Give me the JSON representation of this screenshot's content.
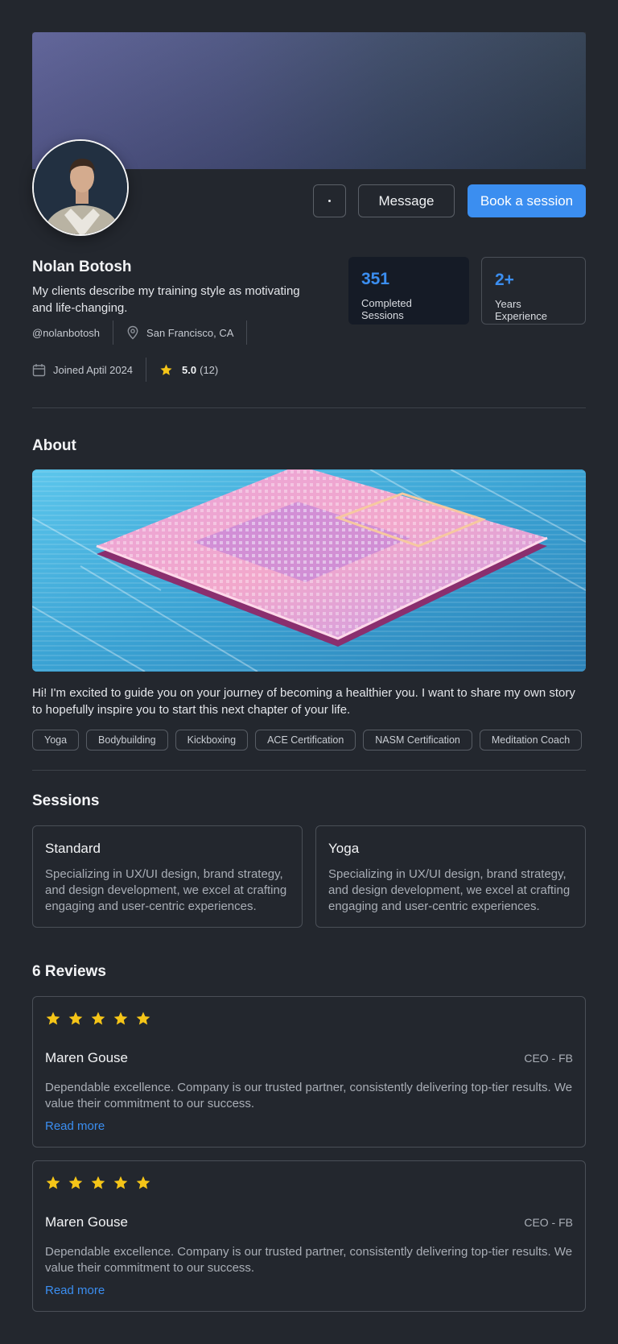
{
  "profile": {
    "name": "Nolan Botosh",
    "tagline": "My clients describe my training style as motivating and life-changing.",
    "handle": "@nolanbotosh",
    "location": "San Francisco, CA",
    "joined": "Joined Aptil 2024",
    "rating": "5.0",
    "rating_count": "(12)"
  },
  "actions": {
    "more_icon": "more-horizontal-icon",
    "message_label": "Message",
    "book_label": "Book a session"
  },
  "stats": [
    {
      "value": "351",
      "label": "Completed Sessions"
    },
    {
      "value": "2+",
      "label": "Years Experience"
    }
  ],
  "about": {
    "title": "About",
    "text": "Hi! I'm excited to guide you on your journey of becoming a healthier you. I want to share my own story to hopefully inspire you to start this next chapter of your life.",
    "tags": [
      "Yoga",
      "Bodybuilding",
      "Kickboxing",
      "ACE Certification",
      "NASM Certification",
      "Meditation Coach"
    ]
  },
  "sessions": {
    "title": "Sessions",
    "items": [
      {
        "title": "Standard",
        "description": "Specializing in UX/UI design, brand strategy, and design development, we excel at crafting engaging and user-centric experiences."
      },
      {
        "title": "Yoga",
        "description": "Specializing in UX/UI design, brand strategy, and design development, we excel at crafting engaging and user-centric experiences."
      }
    ]
  },
  "reviews": {
    "title": "6 Reviews",
    "items": [
      {
        "stars": 5,
        "name": "Maren Gouse",
        "role": "CEO - FB",
        "text": "Dependable excellence. Company is our trusted partner, consistently delivering top-tier results. We value their commitment to our success.",
        "link": "Read more"
      },
      {
        "stars": 5,
        "name": "Maren Gouse",
        "role": "CEO - FB",
        "text": "Dependable excellence. Company is our trusted partner, consistently delivering top-tier results. We value their commitment to our success.",
        "link": "Read more"
      }
    ]
  },
  "colors": {
    "background": "#23272e",
    "accent": "#3b8ef0",
    "star": "#f5c518"
  }
}
